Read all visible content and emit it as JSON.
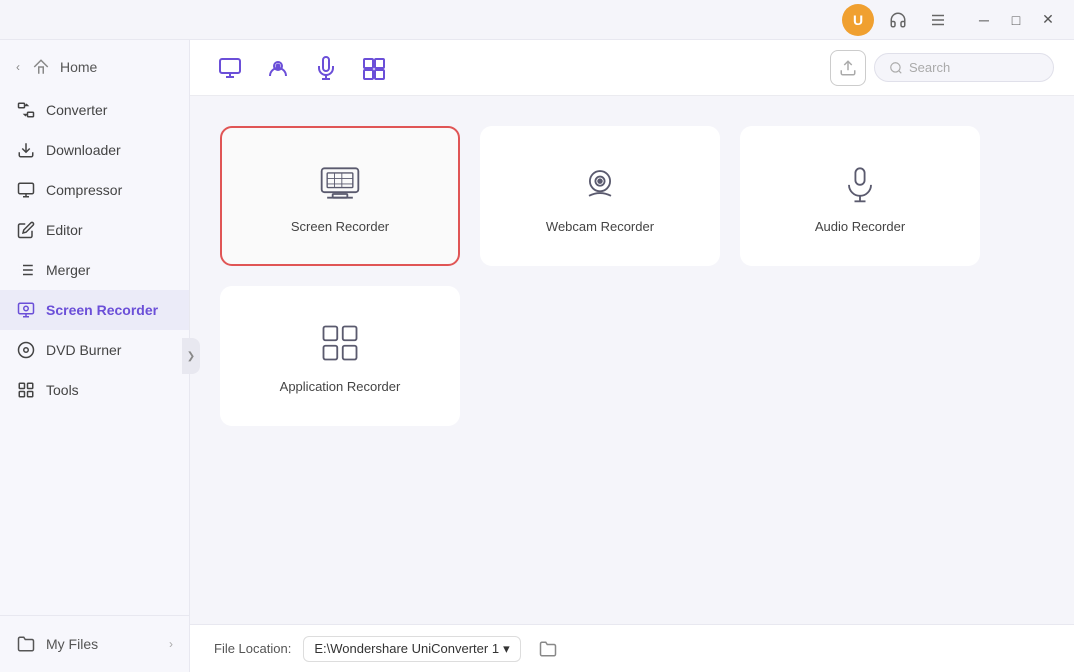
{
  "titlebar": {
    "user_icon_label": "U",
    "support_icon": "headset-icon",
    "menu_icon": "menu-icon",
    "minimize_label": "─",
    "maximize_label": "□",
    "close_label": "✕"
  },
  "sidebar": {
    "home_label": "Home",
    "items": [
      {
        "id": "converter",
        "label": "Converter"
      },
      {
        "id": "downloader",
        "label": "Downloader"
      },
      {
        "id": "compressor",
        "label": "Compressor"
      },
      {
        "id": "editor",
        "label": "Editor"
      },
      {
        "id": "merger",
        "label": "Merger"
      },
      {
        "id": "screen-recorder",
        "label": "Screen Recorder"
      },
      {
        "id": "dvd-burner",
        "label": "DVD Burner"
      },
      {
        "id": "tools",
        "label": "Tools"
      }
    ],
    "active_item": "screen-recorder",
    "bottom_items": [
      {
        "id": "my-files",
        "label": "My Files"
      }
    ]
  },
  "toolbar": {
    "icons": [
      {
        "id": "screen-tab",
        "title": "Screen Recorder tab"
      },
      {
        "id": "webcam-tab",
        "title": "Webcam tab"
      },
      {
        "id": "audio-tab",
        "title": "Audio tab"
      },
      {
        "id": "apps-tab",
        "title": "Apps tab"
      }
    ],
    "search_placeholder": "Search"
  },
  "cards": [
    {
      "id": "screen-recorder",
      "label": "Screen Recorder",
      "selected": true,
      "row": 0
    },
    {
      "id": "webcam-recorder",
      "label": "Webcam Recorder",
      "selected": false,
      "row": 0
    },
    {
      "id": "audio-recorder",
      "label": "Audio Recorder",
      "selected": false,
      "row": 0
    },
    {
      "id": "application-recorder",
      "label": "Application Recorder",
      "selected": false,
      "row": 1
    }
  ],
  "bottom_bar": {
    "file_location_label": "File Location:",
    "file_location_value": "E:\\Wondershare UniConverter 1",
    "dropdown_arrow": "▾"
  }
}
